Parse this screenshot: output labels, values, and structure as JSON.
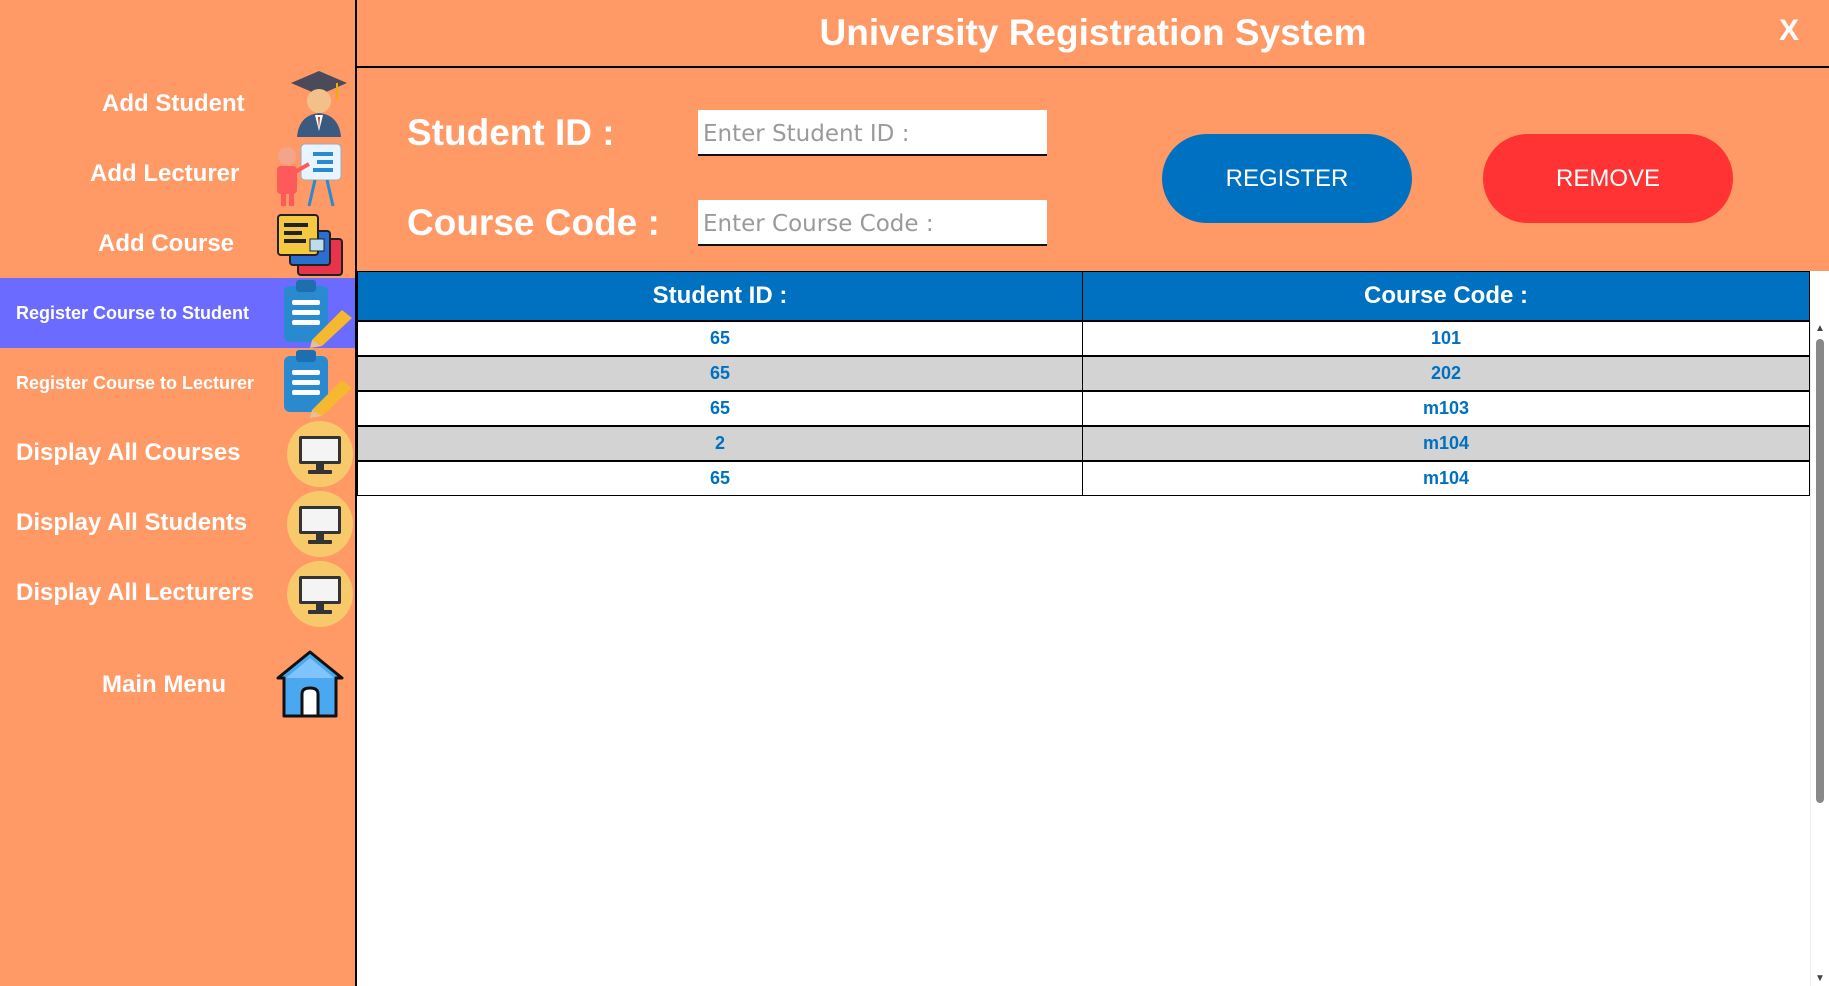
{
  "app": {
    "title": "University Registration System",
    "close_label": "X"
  },
  "sidebar": {
    "items": [
      {
        "label": "Add Student",
        "icon": "graduate-student-icon",
        "active": false
      },
      {
        "label": "Add Lecturer",
        "icon": "lecturer-presentation-icon",
        "active": false
      },
      {
        "label": "Add Course",
        "icon": "books-course-icon",
        "active": false
      },
      {
        "label": "Register Course to Student",
        "icon": "clipboard-pencil-icon",
        "active": true
      },
      {
        "label": "Register Course to Lecturer",
        "icon": "clipboard-pencil-icon",
        "active": false
      },
      {
        "label": "Display All Courses",
        "icon": "monitor-icon",
        "active": false
      },
      {
        "label": "Display All Students",
        "icon": "monitor-icon",
        "active": false
      },
      {
        "label": "Display All Lecturers",
        "icon": "monitor-icon",
        "active": false
      },
      {
        "label": "Main Menu",
        "icon": "home-icon",
        "active": false
      }
    ]
  },
  "form": {
    "student_id_label": "Student ID :",
    "student_id_placeholder": "Enter Student ID :",
    "student_id_value": "",
    "course_code_label": "Course Code :",
    "course_code_placeholder": "Enter Course Code :",
    "course_code_value": "",
    "register_label": "REGISTER",
    "remove_label": "REMOVE"
  },
  "table": {
    "columns": [
      "Student ID :",
      "Course Code :"
    ],
    "rows": [
      [
        "65",
        "101"
      ],
      [
        "65",
        "202"
      ],
      [
        "65",
        "m103"
      ],
      [
        "2",
        "m104"
      ],
      [
        "65",
        "m104"
      ]
    ]
  },
  "colors": {
    "background": "#ff9966",
    "active_nav": "#6b6bff",
    "header_blue": "#0070c0",
    "register_button": "#0070c0",
    "remove_button": "#ff3333",
    "alt_row": "#d3d3d3"
  }
}
